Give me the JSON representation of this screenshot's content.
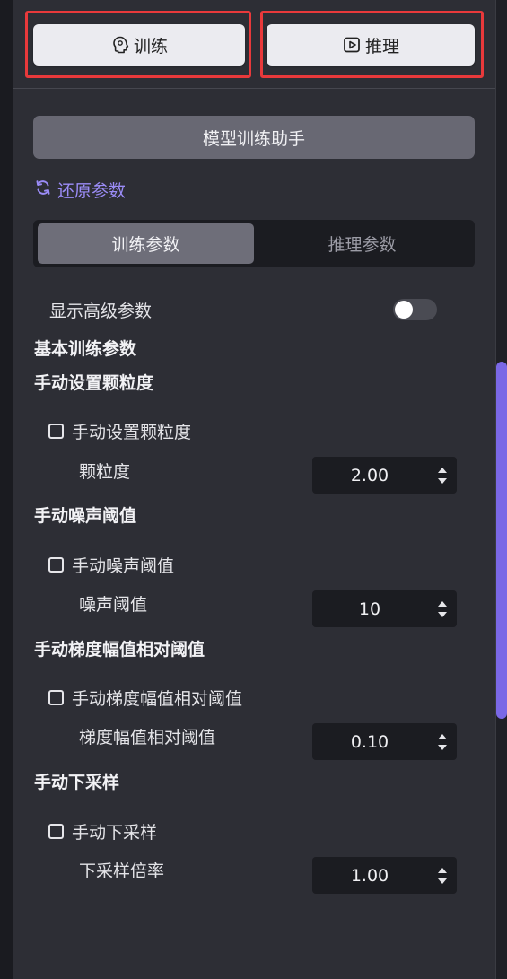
{
  "top_tabs": {
    "train_label": "训练",
    "infer_label": "推理"
  },
  "assistant_button": "模型训练助手",
  "restore_label": "还原参数",
  "segment": {
    "train_params": "训练参数",
    "infer_params": "推理参数"
  },
  "advanced_toggle": {
    "label": "显示高级参数",
    "on": false
  },
  "basic_section_title": "基本训练参数",
  "sections": [
    {
      "title": "手动设置颗粒度",
      "checkbox_label": "手动设置颗粒度",
      "checked": false,
      "field_label": "颗粒度",
      "value": "2.00"
    },
    {
      "title": "手动噪声阈值",
      "checkbox_label": "手动噪声阈值",
      "checked": false,
      "field_label": "噪声阈值",
      "value": "10"
    },
    {
      "title": "手动梯度幅值相对阈值",
      "checkbox_label": "手动梯度幅值相对阈值",
      "checked": false,
      "field_label": "梯度幅值相对阈值",
      "value": "0.10"
    },
    {
      "title": "手动下采样",
      "checkbox_label": "手动下采样",
      "checked": false,
      "field_label": "下采样倍率",
      "value": "1.00"
    }
  ],
  "colors": {
    "accent": "#9b8cf7",
    "highlight_frame": "#e8393b",
    "scroll_thumb": "#7a68e6"
  }
}
